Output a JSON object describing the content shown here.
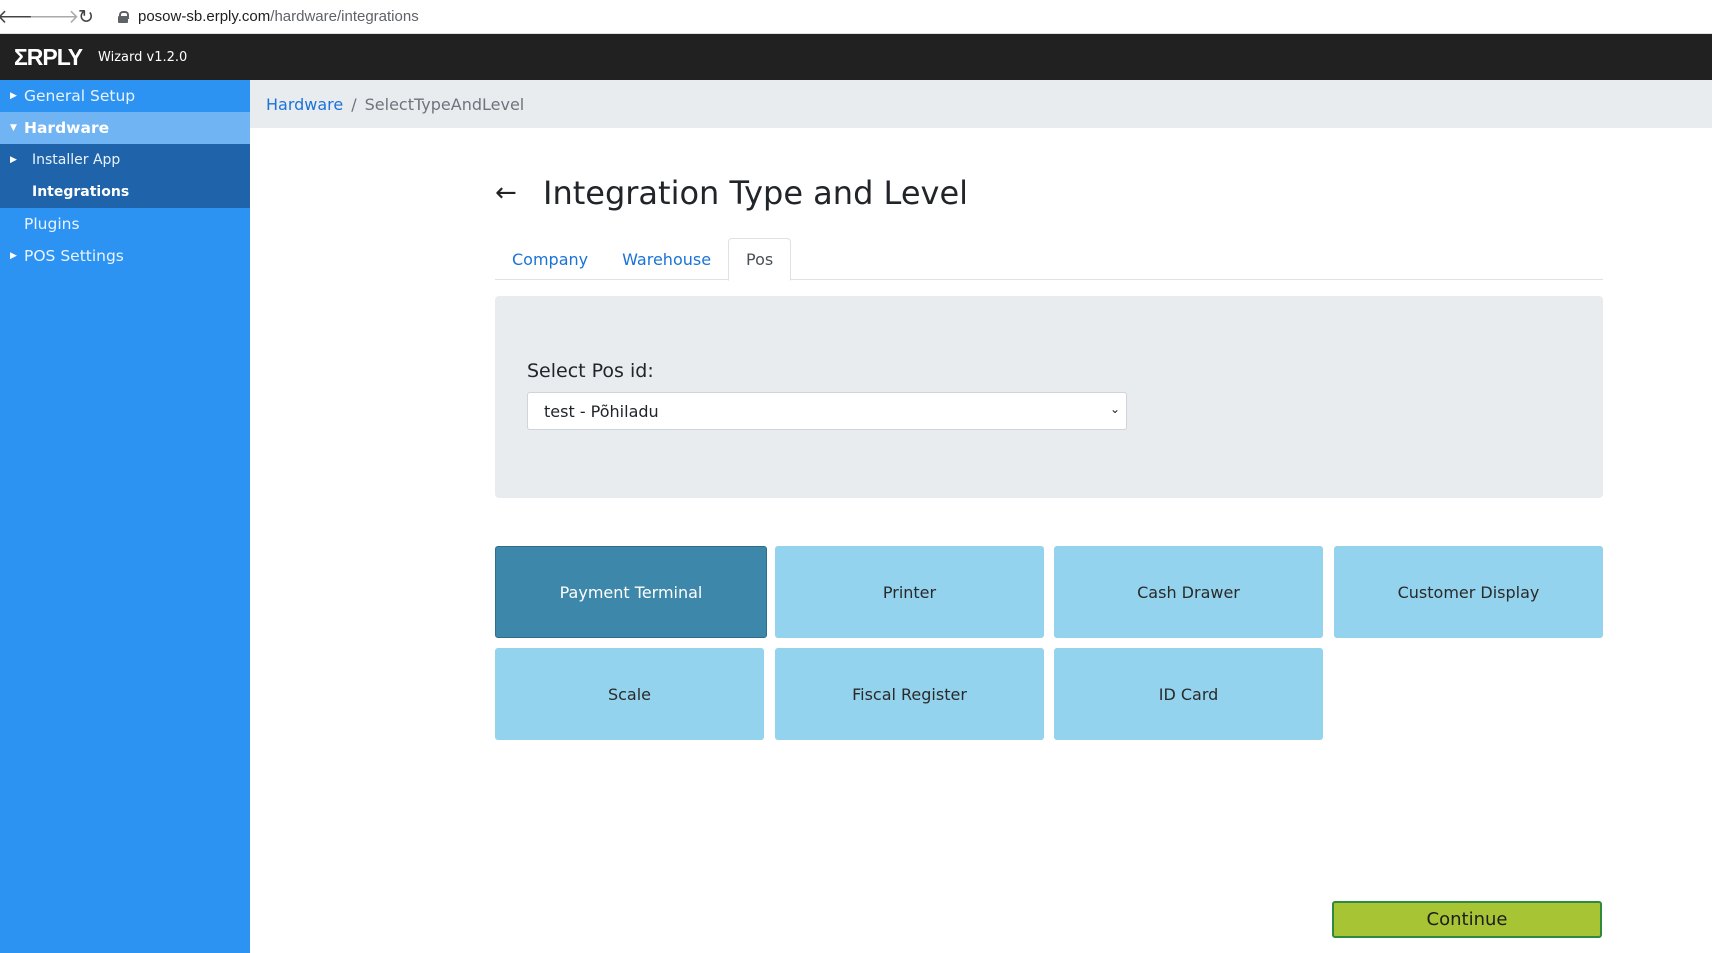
{
  "browser": {
    "url_host": "posow-sb.erply.com",
    "url_path": "/hardware/integrations"
  },
  "app": {
    "logo": "ΣRPLY",
    "version": "Wizard v1.2.0"
  },
  "sidebar": {
    "items": [
      {
        "label": "General Setup"
      },
      {
        "label": "Hardware"
      },
      {
        "label": "Installer App"
      },
      {
        "label": "Integrations"
      },
      {
        "label": "Plugins"
      },
      {
        "label": "POS Settings"
      }
    ]
  },
  "breadcrumb": {
    "link": "Hardware",
    "separator": "/",
    "current": "SelectTypeAndLevel"
  },
  "main": {
    "back": "←",
    "title": "Integration Type and Level",
    "tabs": [
      {
        "label": "Company"
      },
      {
        "label": "Warehouse"
      },
      {
        "label": "Pos"
      }
    ],
    "select_label": "Select Pos id:",
    "select_value": "test - Põhiladu",
    "tiles": [
      {
        "label": "Payment Terminal"
      },
      {
        "label": "Printer"
      },
      {
        "label": "Cash Drawer"
      },
      {
        "label": "Customer Display"
      },
      {
        "label": "Scale"
      },
      {
        "label": "Fiscal Register"
      },
      {
        "label": "ID Card"
      }
    ],
    "continue_label": "Continue"
  },
  "colors": {
    "sidebar": "#2d93f2",
    "tile": "#93d3ee",
    "tile_active": "#3c87aa",
    "continue": "#a6c433"
  }
}
